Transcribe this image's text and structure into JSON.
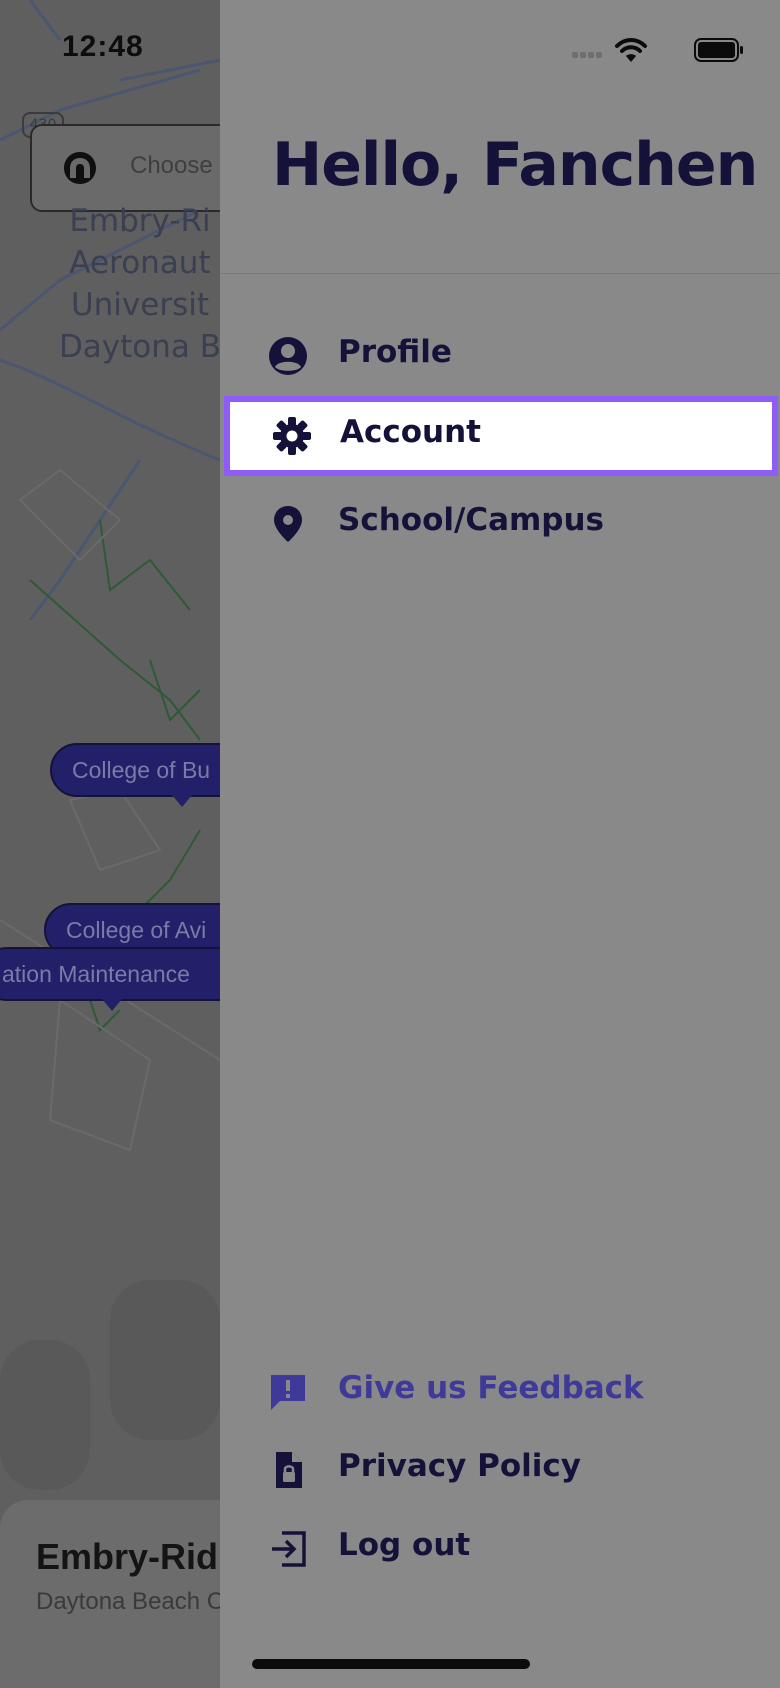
{
  "status_bar": {
    "time": "12:48"
  },
  "map": {
    "search_placeholder": "Choose a",
    "route_shield": "430",
    "labels": [
      "Embry-Ri",
      "Aeronaut",
      "Universit",
      "Daytona B"
    ],
    "pins": [
      "College of Bu",
      "College of Avi",
      "ation Maintenance"
    ],
    "bottom_card": {
      "title": "Embry-Rid",
      "subtitle": "Daytona Beach C"
    }
  },
  "drawer": {
    "greeting": "Hello, Fanchen",
    "menu": [
      {
        "label": "Profile",
        "icon": "user-circle-icon"
      },
      {
        "label": "Account",
        "icon": "gear-icon",
        "selected": true
      },
      {
        "label": "School/Campus",
        "icon": "map-pin-icon"
      }
    ],
    "footer": [
      {
        "label": "Give us Feedback",
        "icon": "feedback-icon"
      },
      {
        "label": "Privacy Policy",
        "icon": "lock-document-icon"
      },
      {
        "label": "Log out",
        "icon": "logout-icon"
      }
    ]
  },
  "colors": {
    "accent_highlight": "#8f5cf7",
    "text_dark": "#15123a",
    "feedback_accent": "#3f3a9a",
    "pin_fill": "#23206a"
  }
}
